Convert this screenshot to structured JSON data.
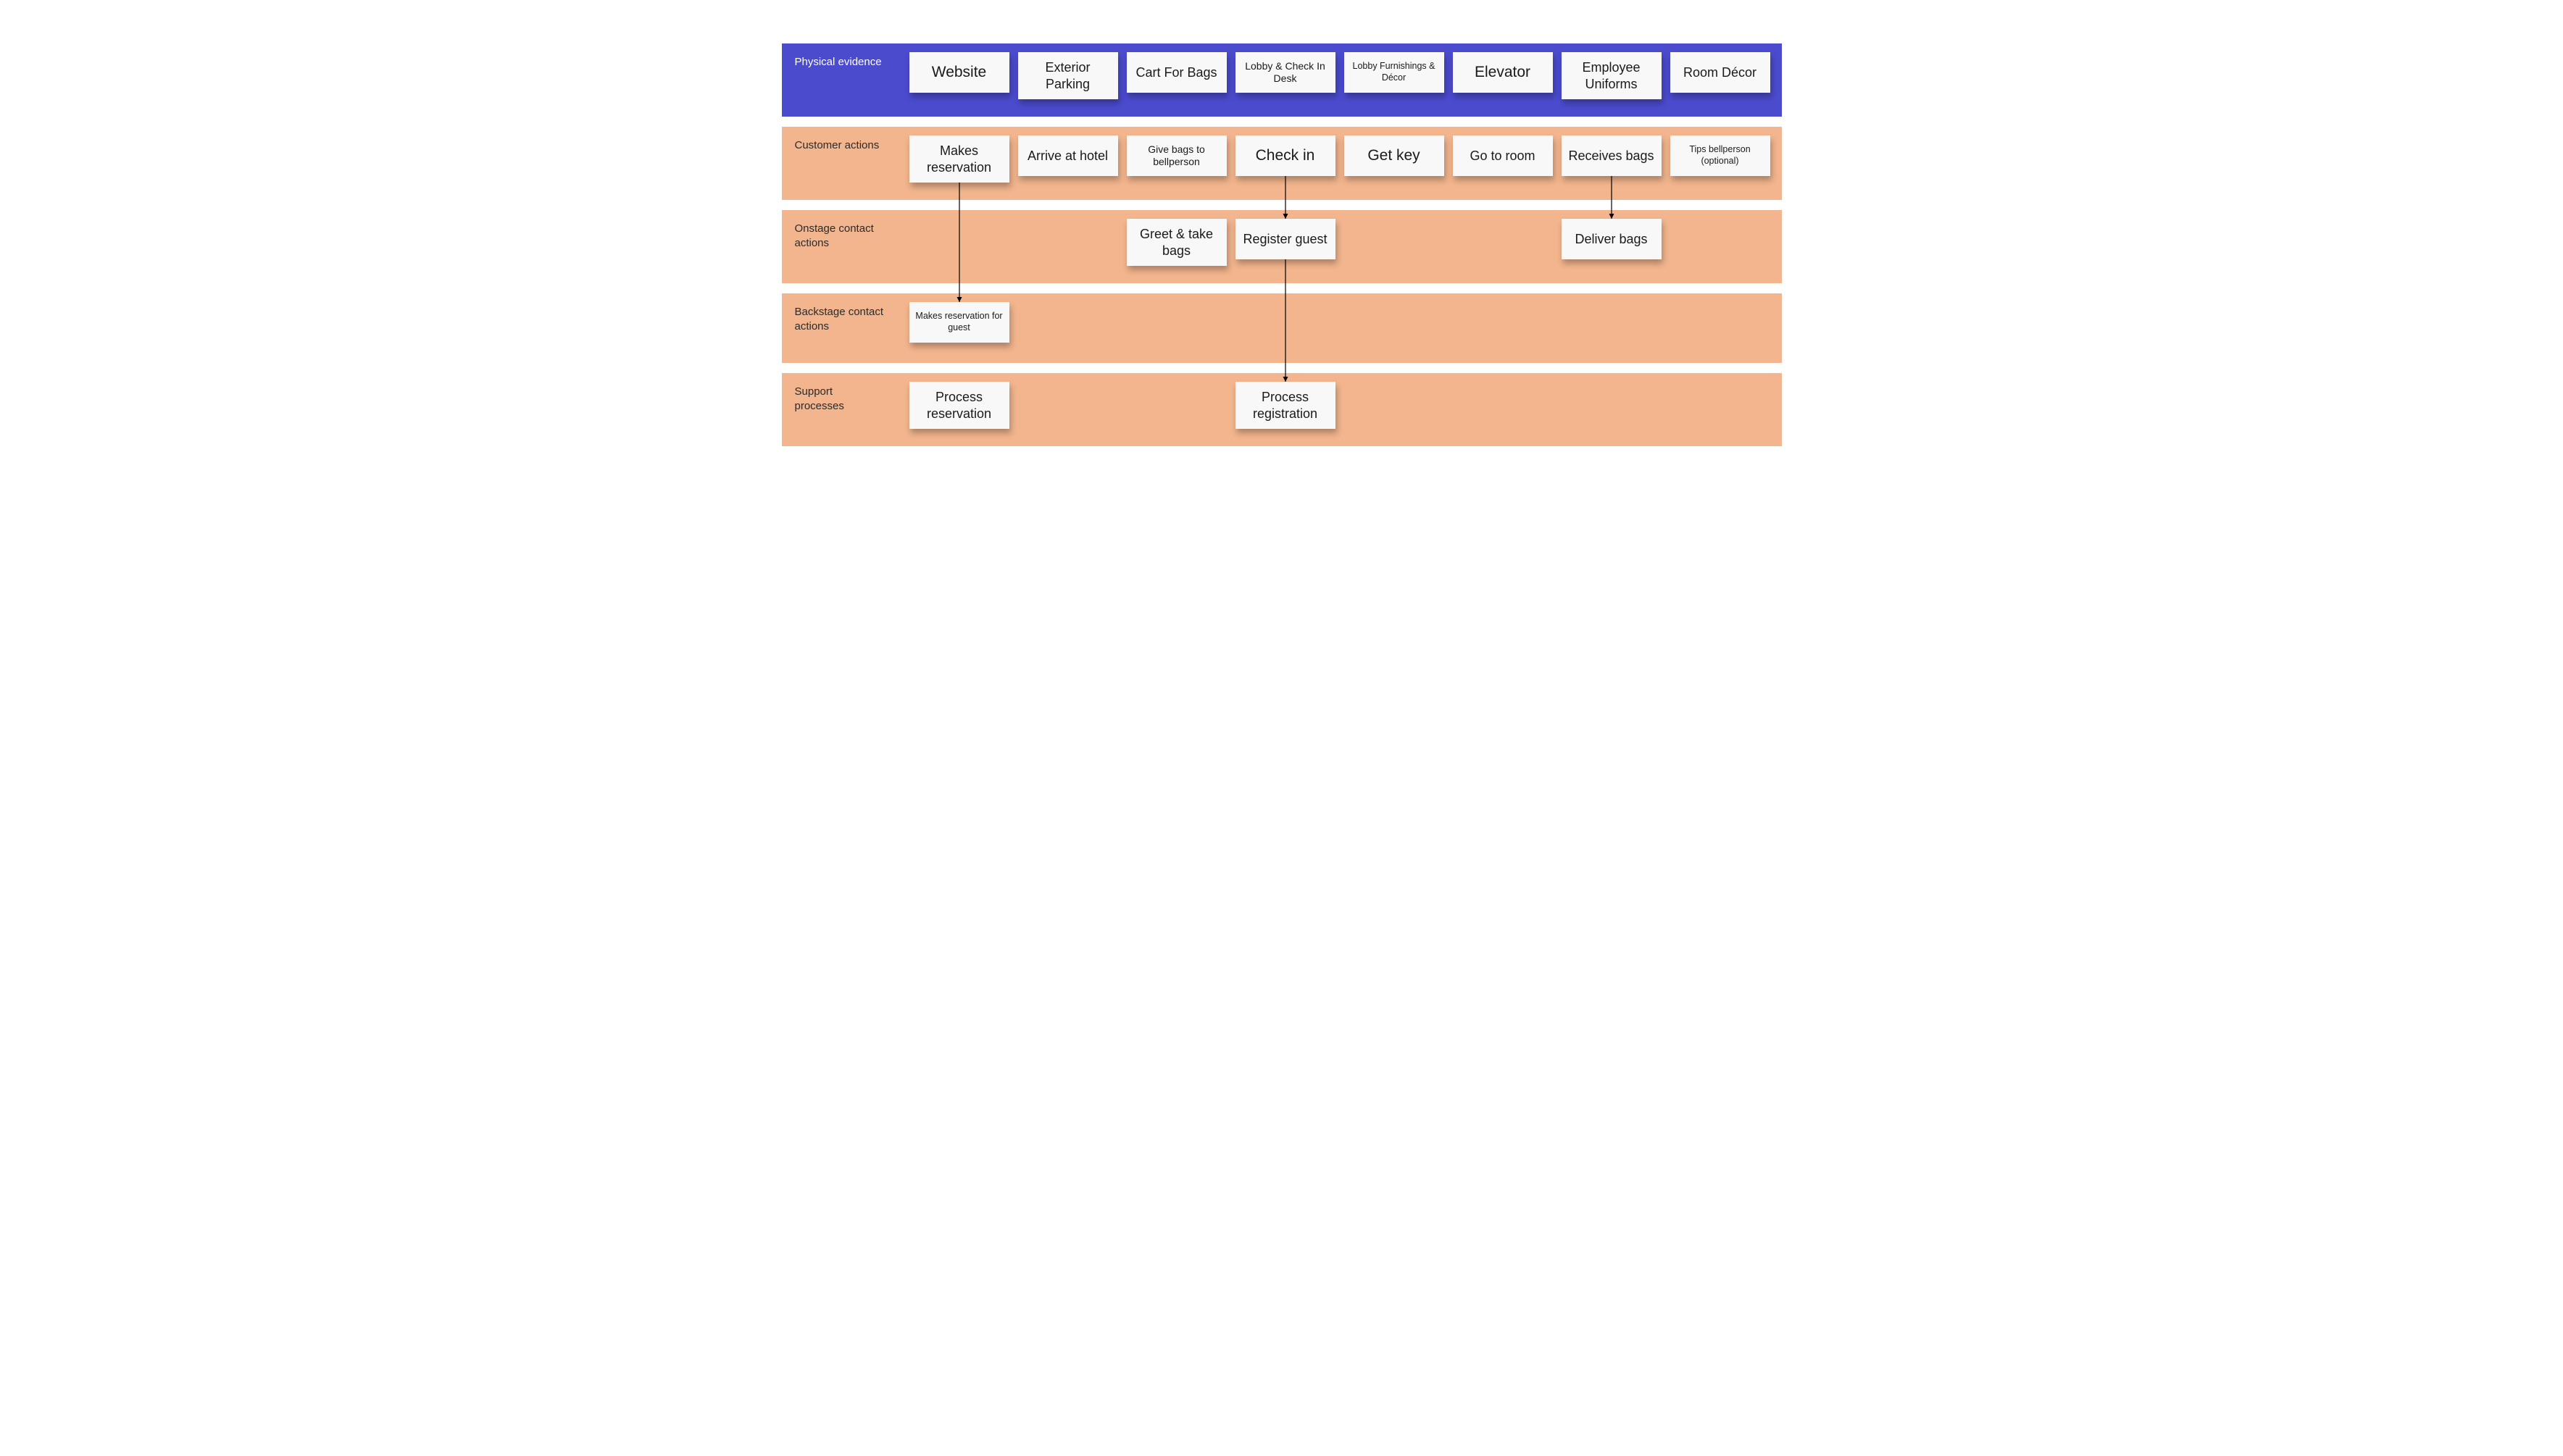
{
  "rows": {
    "physical_evidence": {
      "label": "Physical evidence",
      "cards": [
        "Website",
        "Exterior Parking",
        "Cart For Bags",
        "Lobby & Check In Desk",
        "Lobby Furnishings & Décor",
        "Elevator",
        "Employee Uniforms",
        "Room Décor"
      ]
    },
    "customer_actions": {
      "label": "Customer actions",
      "cards": [
        "Makes reservation",
        "Arrive at hotel",
        "Give bags to bellperson",
        "Check in",
        "Get key",
        "Go to room",
        "Receives bags",
        "Tips bellperson (optional)"
      ]
    },
    "onstage_contact": {
      "label": "Onstage contact actions",
      "cards": {
        "2": "Greet & take bags",
        "3": "Register guest",
        "6": "Deliver bags"
      }
    },
    "backstage_contact": {
      "label": "Backstage contact actions",
      "cards": {
        "0": "Makes reservation for guest"
      }
    },
    "support_processes": {
      "label": "Support processes",
      "cards": {
        "0": "Process reservation",
        "3": "Process registration"
      }
    }
  },
  "arrows": [
    {
      "from": "customer_actions.0",
      "to": "backstage_contact.0"
    },
    {
      "from": "customer_actions.3",
      "to": "onstage_contact.3"
    },
    {
      "from": "onstage_contact.3",
      "to": "support_processes.3"
    },
    {
      "from": "customer_actions.6",
      "to": "onstage_contact.6"
    }
  ],
  "colors": {
    "purple": "#4b4bce",
    "peach": "#f2b58d",
    "card": "#f8f8f8"
  }
}
